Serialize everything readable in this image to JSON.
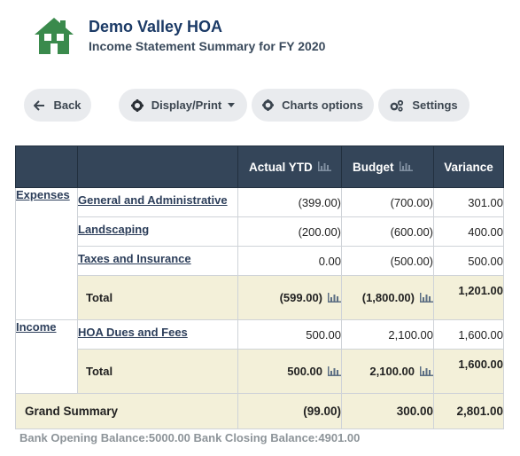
{
  "header": {
    "org_name": "Demo Valley HOA",
    "report_title": "Income Statement Summary for FY 2020",
    "logo_icon": "house-icon",
    "logo_color": "#3a8a4c"
  },
  "toolbar": {
    "back_label": "Back",
    "display_print_label": "Display/Print",
    "charts_options_label": "Charts options",
    "settings_label": "Settings"
  },
  "table": {
    "columns": [
      "",
      "",
      "Actual YTD",
      "Budget",
      "Variance"
    ],
    "expenses": {
      "category": "Expenses",
      "rows": [
        {
          "account": "General and Administrative",
          "actual": "(399.00)",
          "budget": "(700.00)",
          "variance": "301.00"
        },
        {
          "account": "Landscaping",
          "actual": "(200.00)",
          "budget": "(600.00)",
          "variance": "400.00"
        },
        {
          "account": "Taxes and Insurance",
          "actual": "0.00",
          "budget": "(500.00)",
          "variance": "500.00"
        }
      ],
      "total": {
        "label": "Total",
        "actual": "(599.00)",
        "budget": "(1,800.00)",
        "variance": "1,201.00"
      }
    },
    "income": {
      "category": "Income",
      "rows": [
        {
          "account": "HOA Dues and Fees",
          "actual": "500.00",
          "budget": "2,100.00",
          "variance": "1,600.00"
        }
      ],
      "total": {
        "label": "Total",
        "actual": "500.00",
        "budget": "2,100.00",
        "variance": "1,600.00"
      }
    },
    "grand": {
      "label": "Grand Summary",
      "actual": "(99.00)",
      "budget": "300.00",
      "variance": "2,801.00"
    }
  },
  "footer": {
    "balances": "Bank Opening Balance:5000.00 Bank Closing Balance:4901.00"
  }
}
